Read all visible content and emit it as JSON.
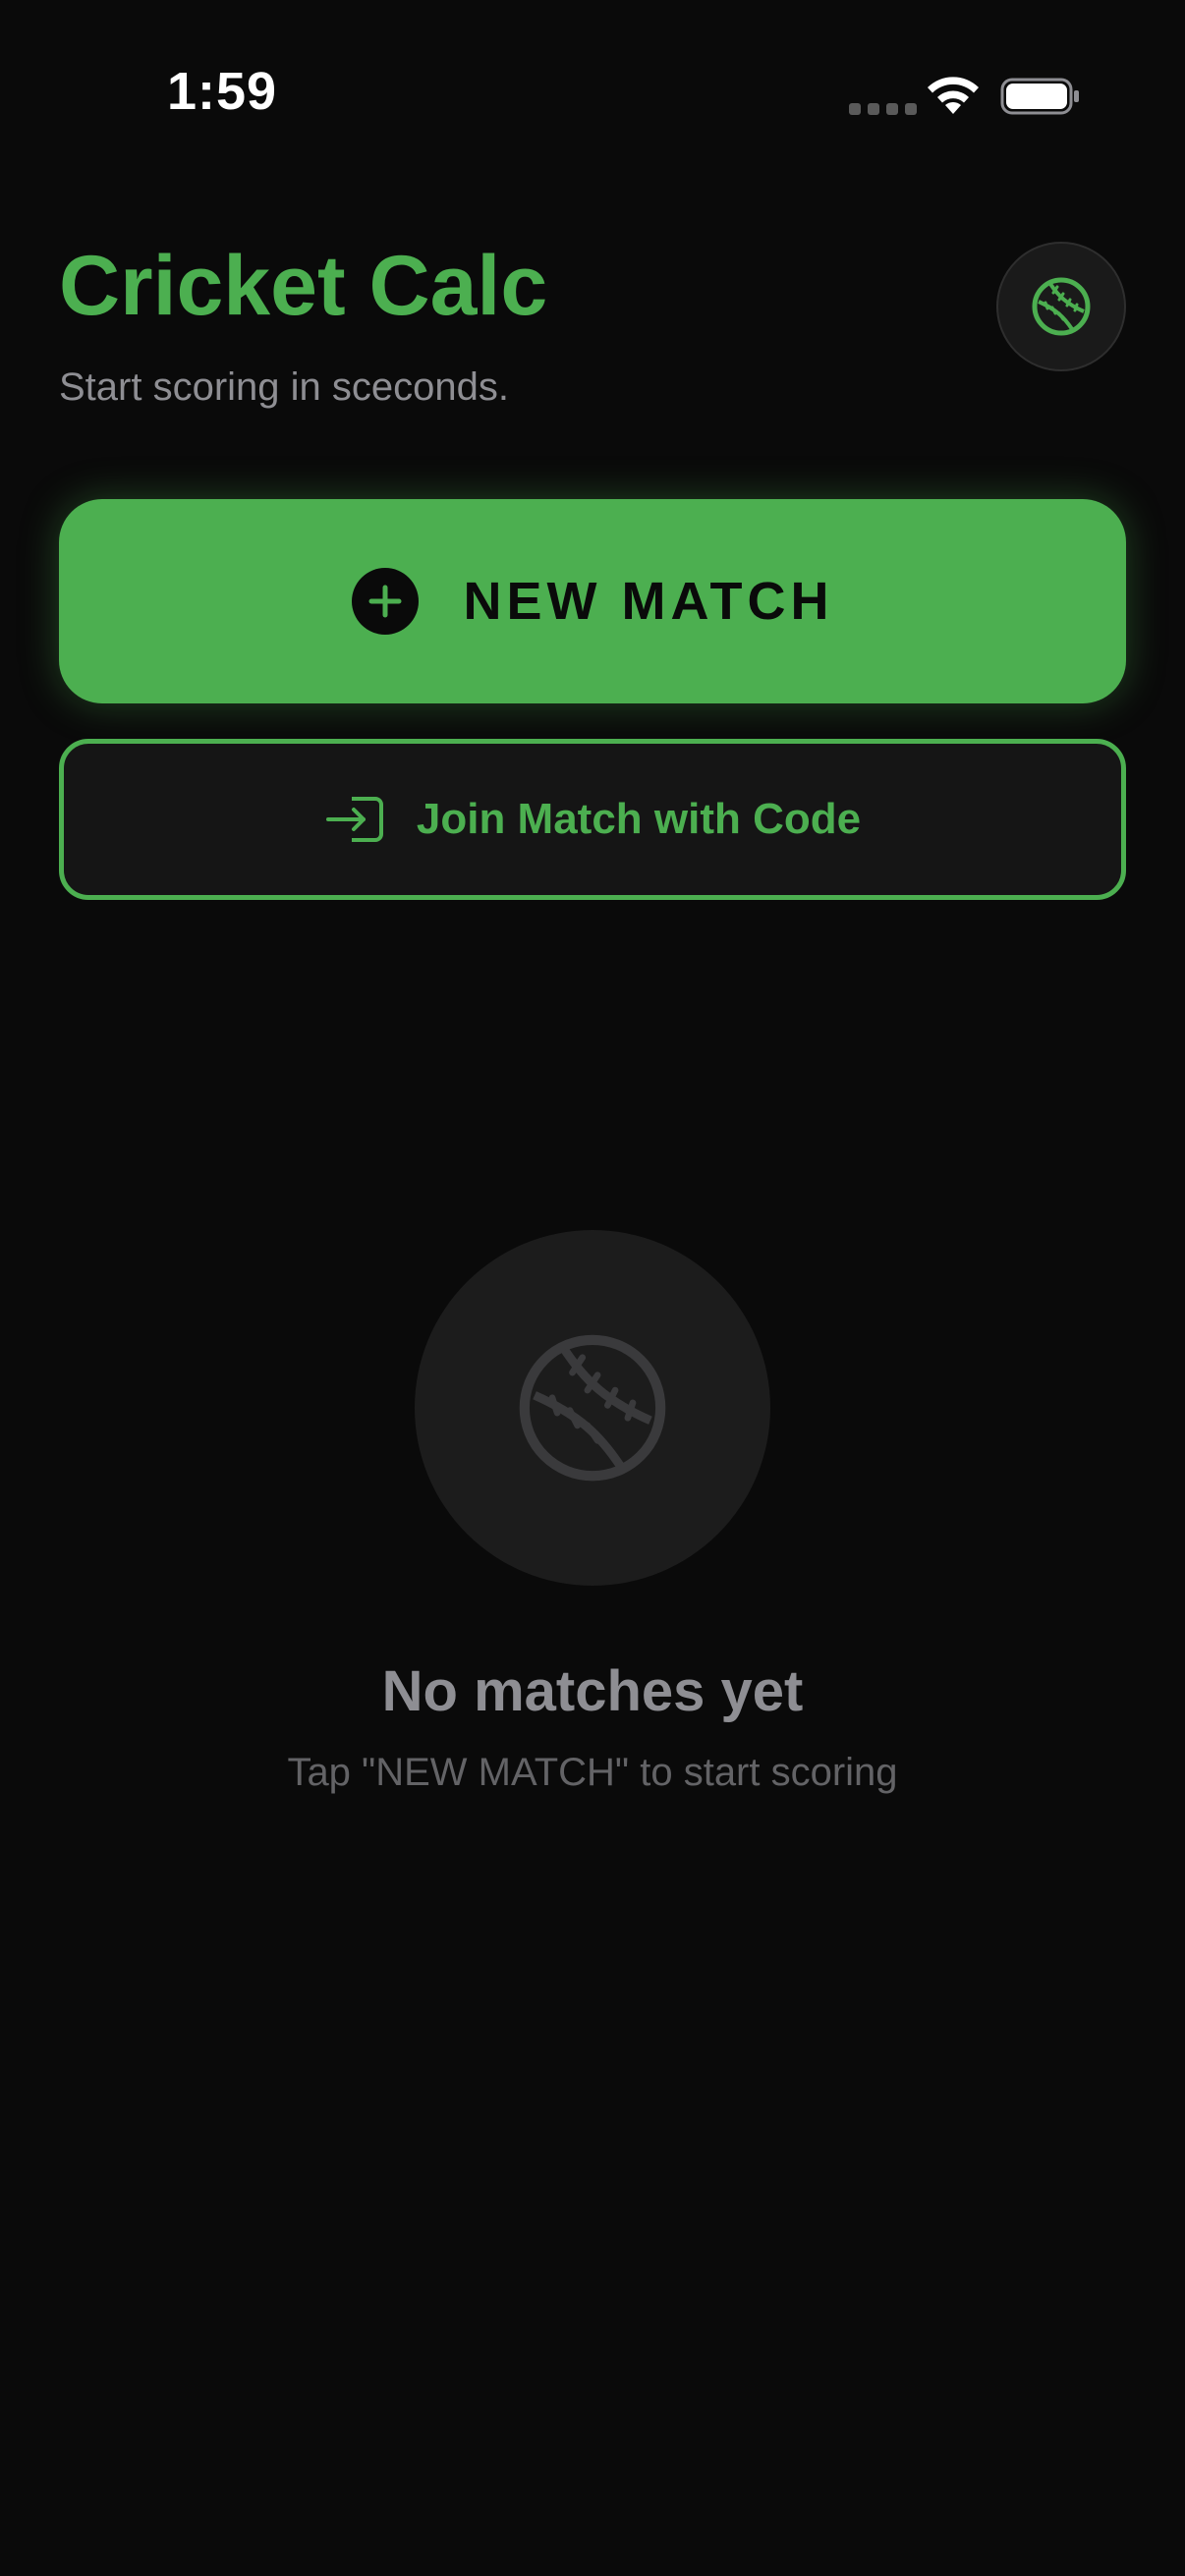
{
  "status_bar": {
    "time": "1:59"
  },
  "header": {
    "title": "Cricket Calc",
    "subtitle": "Start scoring in sceconds."
  },
  "actions": {
    "new_match_label": "NEW MATCH",
    "join_label": "Join Match with Code"
  },
  "empty_state": {
    "title": "No matches yet",
    "subtitle": "Tap \"NEW MATCH\" to start scoring"
  },
  "colors": {
    "accent": "#4caf50",
    "background": "#0a0a0a",
    "muted_text": "#8e8e93"
  },
  "icons": {
    "profile": "baseball-icon",
    "new_match": "plus-circle-icon",
    "join": "enter-icon",
    "empty": "baseball-icon",
    "wifi": "wifi-icon",
    "battery": "battery-icon"
  }
}
